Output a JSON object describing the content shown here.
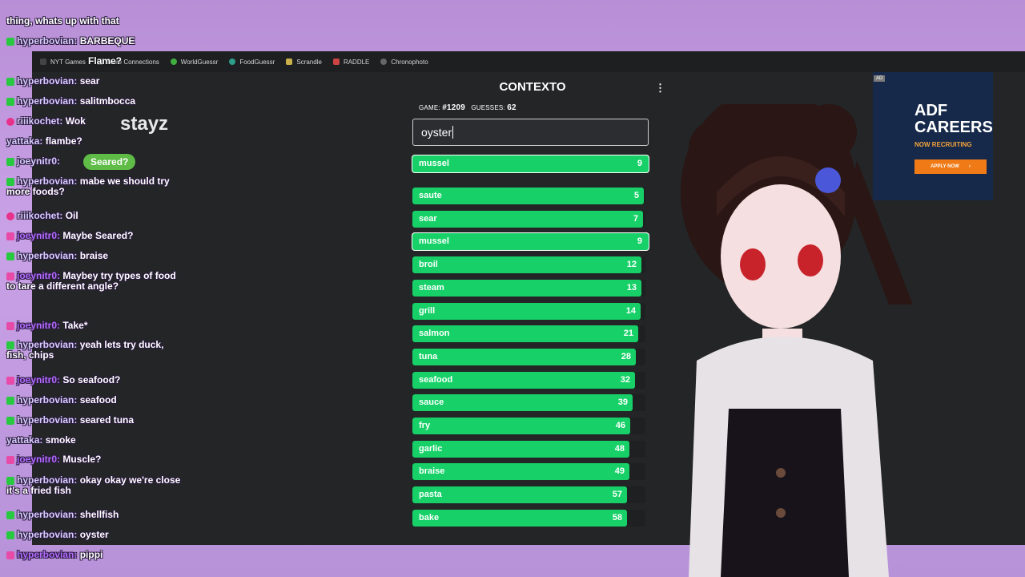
{
  "bookmarks": [
    "NYT Games",
    "More Connections",
    "WorldGuessr",
    "FoodGuessr",
    "Scrandle",
    "RADDLE",
    "Chronophoto"
  ],
  "contexto": {
    "title": "CONTEXTO",
    "game_label": "GAME:",
    "game_number": "#1209",
    "guesses_label": "GUESSES:",
    "guesses_count": "62",
    "input_value": "oyster",
    "current_guess": {
      "word": "mussel",
      "rank": "9"
    },
    "guesses": [
      {
        "word": "saute",
        "rank": "5"
      },
      {
        "word": "sear",
        "rank": "7"
      },
      {
        "word": "mussel",
        "rank": "9",
        "highlight": true
      },
      {
        "word": "broil",
        "rank": "12"
      },
      {
        "word": "steam",
        "rank": "13"
      },
      {
        "word": "grill",
        "rank": "14"
      },
      {
        "word": "salmon",
        "rank": "21"
      },
      {
        "word": "tuna",
        "rank": "28"
      },
      {
        "word": "seafood",
        "rank": "32"
      },
      {
        "word": "sauce",
        "rank": "39"
      },
      {
        "word": "fry",
        "rank": "46"
      },
      {
        "word": "garlic",
        "rank": "48"
      },
      {
        "word": "braise",
        "rank": "49"
      },
      {
        "word": "pasta",
        "rank": "57"
      },
      {
        "word": "bake",
        "rank": "58"
      }
    ],
    "bar_color": "#17d168"
  },
  "ad": {
    "badge": "AD",
    "logo": "ADF CAREERS",
    "tagline": "NOW RECRUITING",
    "button": "APPLY NOW"
  },
  "chat": {
    "top_text": "thing, whats up with that",
    "poll_flame": "Flame?",
    "poll_seared": "Seared?",
    "sponsor": "stayz",
    "messages": [
      {
        "user": "hyperbovian:",
        "text": "BARBEQUE",
        "badge": "check"
      },
      {
        "user": "hyperbovian:",
        "text": "sear",
        "badge": "check"
      },
      {
        "user": "hyperbovian:",
        "text": "salitmbocca",
        "badge": "check"
      },
      {
        "user": "riiikochet:",
        "text": "Wok",
        "badge": "heart"
      },
      {
        "user": "yattaka:",
        "text": "flambe?",
        "badge": ""
      },
      {
        "user": "joeynitr0:",
        "text": "",
        "badge": "check"
      },
      {
        "user": "hyperbovian:",
        "text": "mabe we should try more foods?",
        "badge": "check"
      },
      {
        "user": "riiikochet:",
        "text": "Oil",
        "badge": "heart"
      },
      {
        "user": "joeynitr0:",
        "text": "Maybe Seared?",
        "badge": "vip"
      },
      {
        "user": "hyperbovian:",
        "text": "braise",
        "badge": "check"
      },
      {
        "user": "joeynitr0:",
        "text": "Maybey try types of food to tare a different angle?",
        "badge": "vip"
      },
      {
        "user": "joeynitr0:",
        "text": "Take*",
        "badge": "vip"
      },
      {
        "user": "hyperbovian:",
        "text": "yeah lets try duck, fish, chips",
        "badge": "check"
      },
      {
        "user": "joeynitr0:",
        "text": "So seafood?",
        "badge": "vip"
      },
      {
        "user": "hyperbovian:",
        "text": "seafood",
        "badge": "check"
      },
      {
        "user": "hyperbovian:",
        "text": "seared tuna",
        "badge": "check"
      },
      {
        "user": "yattaka:",
        "text": "smoke",
        "badge": ""
      },
      {
        "user": "joeynitr0:",
        "text": "Muscle?",
        "badge": "vip"
      },
      {
        "user": "hyperbovian:",
        "text": "okay okay we're close it's a fried fish",
        "badge": "check"
      },
      {
        "user": "hyperbovian:",
        "text": "shellfish",
        "badge": "check"
      },
      {
        "user": "hyperbovian:",
        "text": "oyster",
        "badge": "check"
      },
      {
        "user": "hyperbovian:",
        "text": "pippi",
        "badge": "vip"
      }
    ]
  }
}
